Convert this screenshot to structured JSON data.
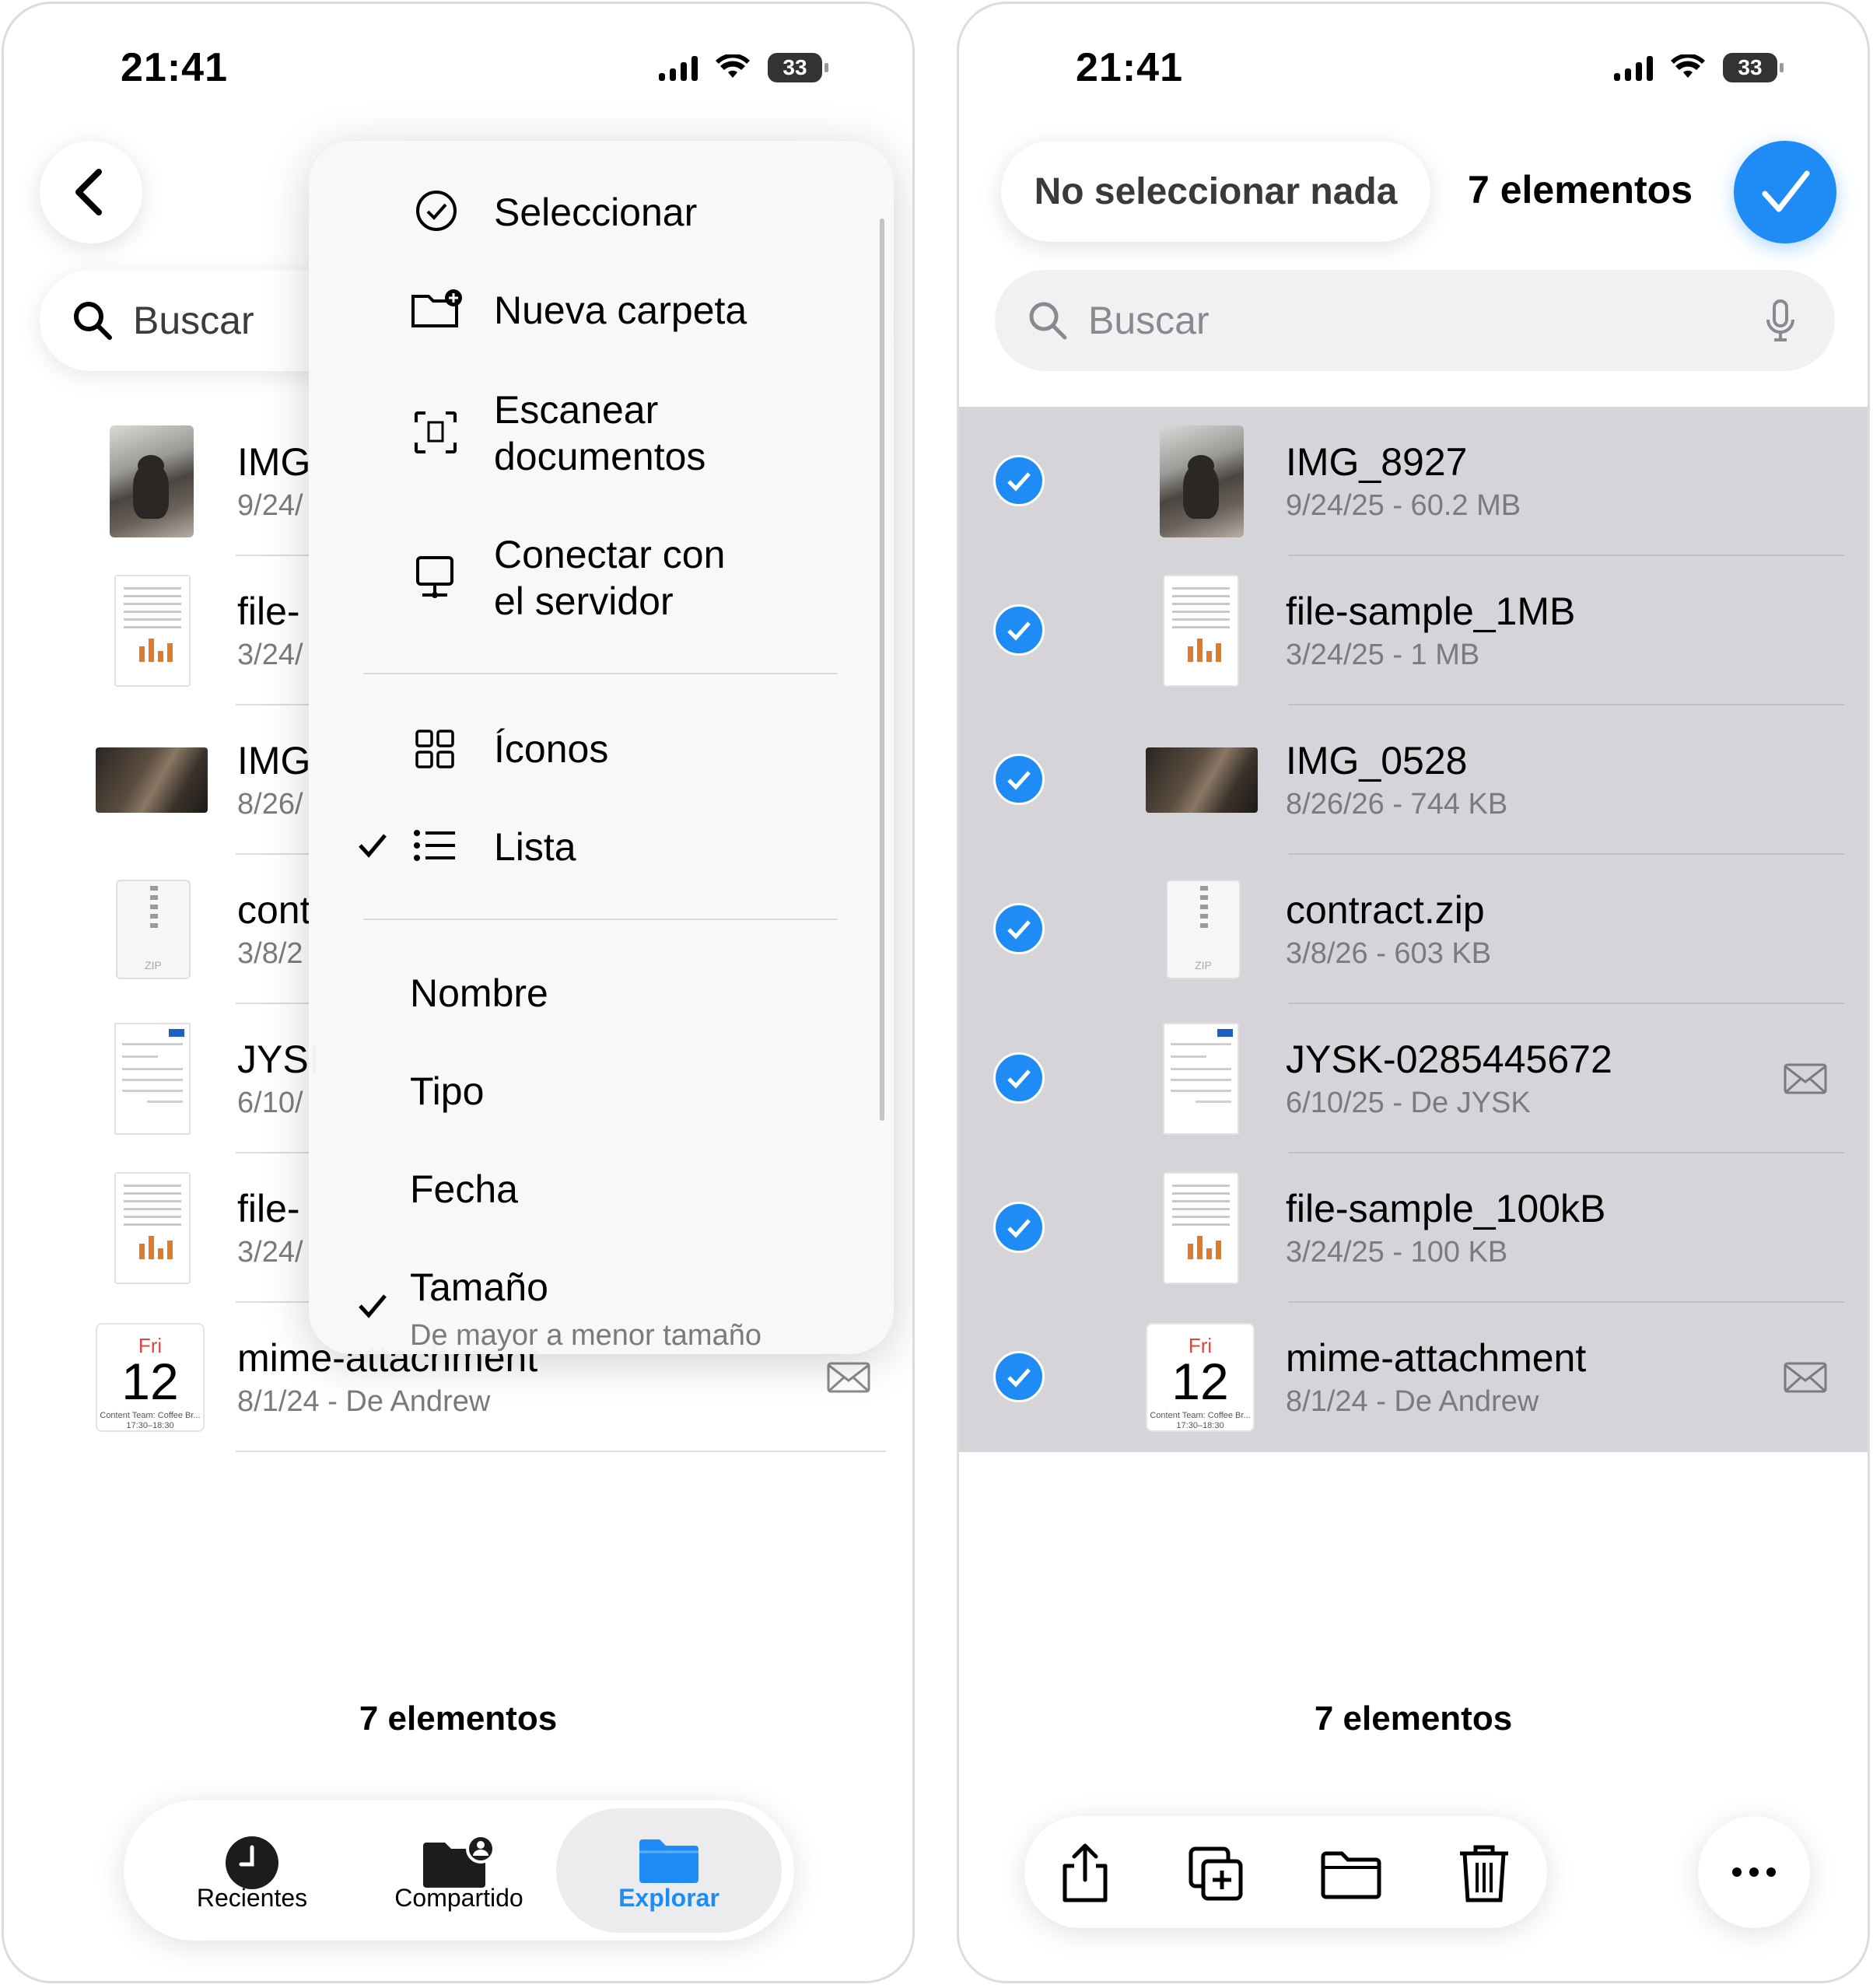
{
  "status": {
    "time": "21:41",
    "battery": "33"
  },
  "search": {
    "placeholder": "Buscar"
  },
  "files": [
    {
      "name": "IMG_8927",
      "meta": "9/24/25 - 60.2 MB",
      "kind": "photo-cat",
      "left_name": "IMG",
      "left_meta": "9/24/"
    },
    {
      "name": "file-sample_1MB",
      "meta": "3/24/25 - 1 MB",
      "kind": "document",
      "left_name": "file-",
      "left_meta": "3/24/"
    },
    {
      "name": "IMG_0528",
      "meta": "8/26/26 - 744 KB",
      "kind": "photo-wide",
      "left_name": "IMG",
      "left_meta": "8/26/"
    },
    {
      "name": "contract.zip",
      "meta": "3/8/26 - 603 KB",
      "kind": "zip",
      "left_name": "cont",
      "left_meta": "3/8/2"
    },
    {
      "name": "JYSK-0285445672",
      "meta": "6/10/25 - De JYSK",
      "kind": "invoice",
      "left_name": "JYSI",
      "left_meta": "6/10/"
    },
    {
      "name": "file-sample_100kB",
      "meta": "3/24/25 - 100 KB",
      "kind": "document",
      "left_name": "file-",
      "left_meta": "3/24/"
    },
    {
      "name": "mime-attachment",
      "meta": "8/1/24 - De Andrew",
      "kind": "calendar",
      "left_name": "mime-attachment",
      "left_meta": "8/1/24 - De Andrew"
    }
  ],
  "calendar_thumb": {
    "day": "Fri",
    "date": "12",
    "caption": "Content Team: Coffee Br... 17:30–18:30"
  },
  "zip_thumb_label": "ZIP",
  "menu": {
    "actions": [
      "Seleccionar",
      "Nueva carpeta",
      "Escanear documentos",
      "Conectar con el servidor"
    ],
    "scan_lines": [
      "Escanear",
      "documentos"
    ],
    "connect_lines": [
      "Conectar con",
      "el servidor"
    ],
    "views": [
      {
        "label": "Íconos",
        "checked": false
      },
      {
        "label": "Lista",
        "checked": true
      }
    ],
    "sort": [
      {
        "label": "Nombre",
        "checked": false
      },
      {
        "label": "Tipo",
        "checked": false
      },
      {
        "label": "Fecha",
        "checked": false
      },
      {
        "label": "Tamaño",
        "checked": true,
        "detail": "De mayor a menor tamaño"
      }
    ]
  },
  "footer": {
    "count": "7 elementos"
  },
  "tabs": [
    {
      "label": "Recientes",
      "active": false
    },
    {
      "label": "Compartido",
      "active": false
    },
    {
      "label": "Explorar",
      "active": true
    }
  ],
  "selection": {
    "deselect_label": "No seleccionar nada",
    "count_label": "7 elementos"
  },
  "colors": {
    "accent": "#1f8cf5",
    "selected_band": "#d5d5d9",
    "secondary_text": "#7b7b7f"
  }
}
